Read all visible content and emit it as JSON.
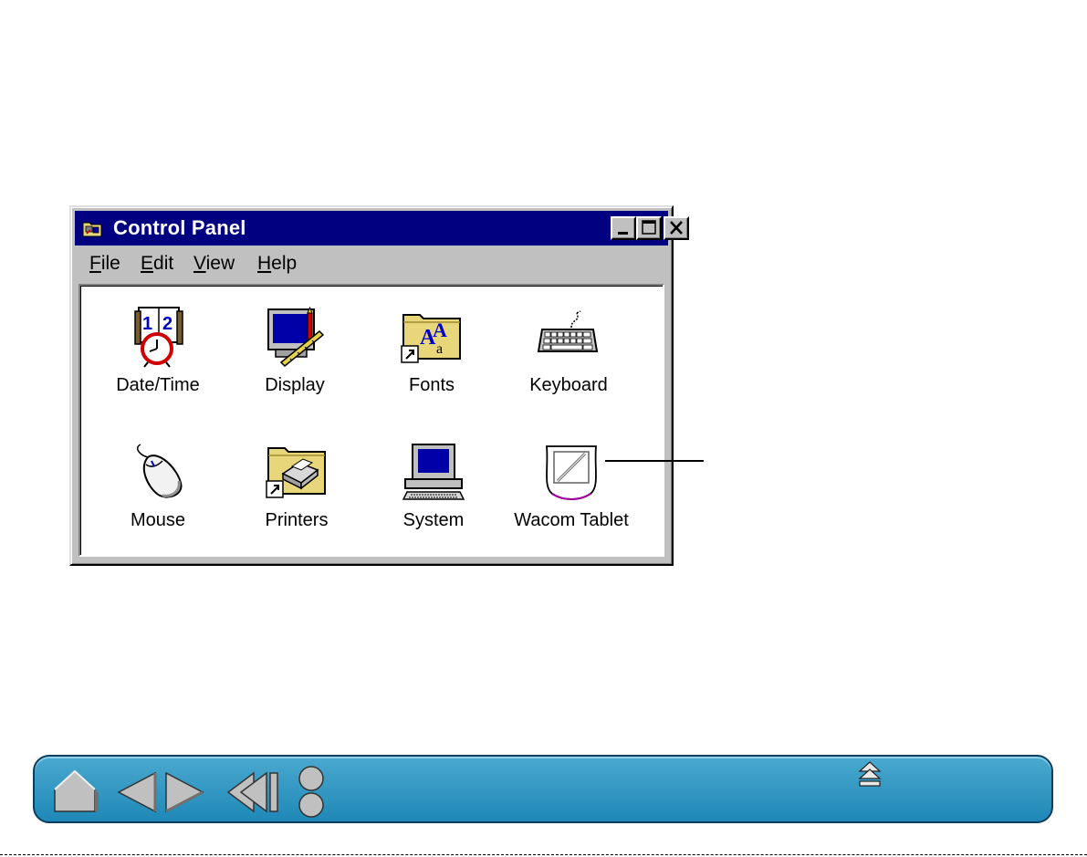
{
  "window": {
    "title": "Control Panel",
    "menu": [
      {
        "label": "File",
        "mnemonic": "F",
        "rest": "ile"
      },
      {
        "label": "Edit",
        "mnemonic": "E",
        "rest": "dit"
      },
      {
        "label": "View",
        "mnemonic": "V",
        "rest": "iew"
      },
      {
        "label": "Help",
        "mnemonic": "H",
        "rest": "elp"
      }
    ],
    "items": [
      {
        "label": "Date/Time",
        "icon": "date-time-icon"
      },
      {
        "label": "Display",
        "icon": "display-icon"
      },
      {
        "label": "Fonts",
        "icon": "fonts-folder-icon"
      },
      {
        "label": "Keyboard",
        "icon": "keyboard-icon"
      },
      {
        "label": "Mouse",
        "icon": "mouse-icon"
      },
      {
        "label": "Printers",
        "icon": "printers-folder-icon"
      },
      {
        "label": "System",
        "icon": "system-computer-icon"
      },
      {
        "label": "Wacom Tablet",
        "icon": "wacom-tablet-icon"
      }
    ]
  },
  "navigation": {
    "buttons": [
      "home-icon",
      "previous-page-icon",
      "next-page-icon",
      "back-icon",
      "toc-index-icon",
      "eject-top-icon"
    ]
  },
  "colors": {
    "titlebar": "#000080",
    "window_face": "#c0c0c0",
    "nav_bar": "#2a93c1"
  }
}
